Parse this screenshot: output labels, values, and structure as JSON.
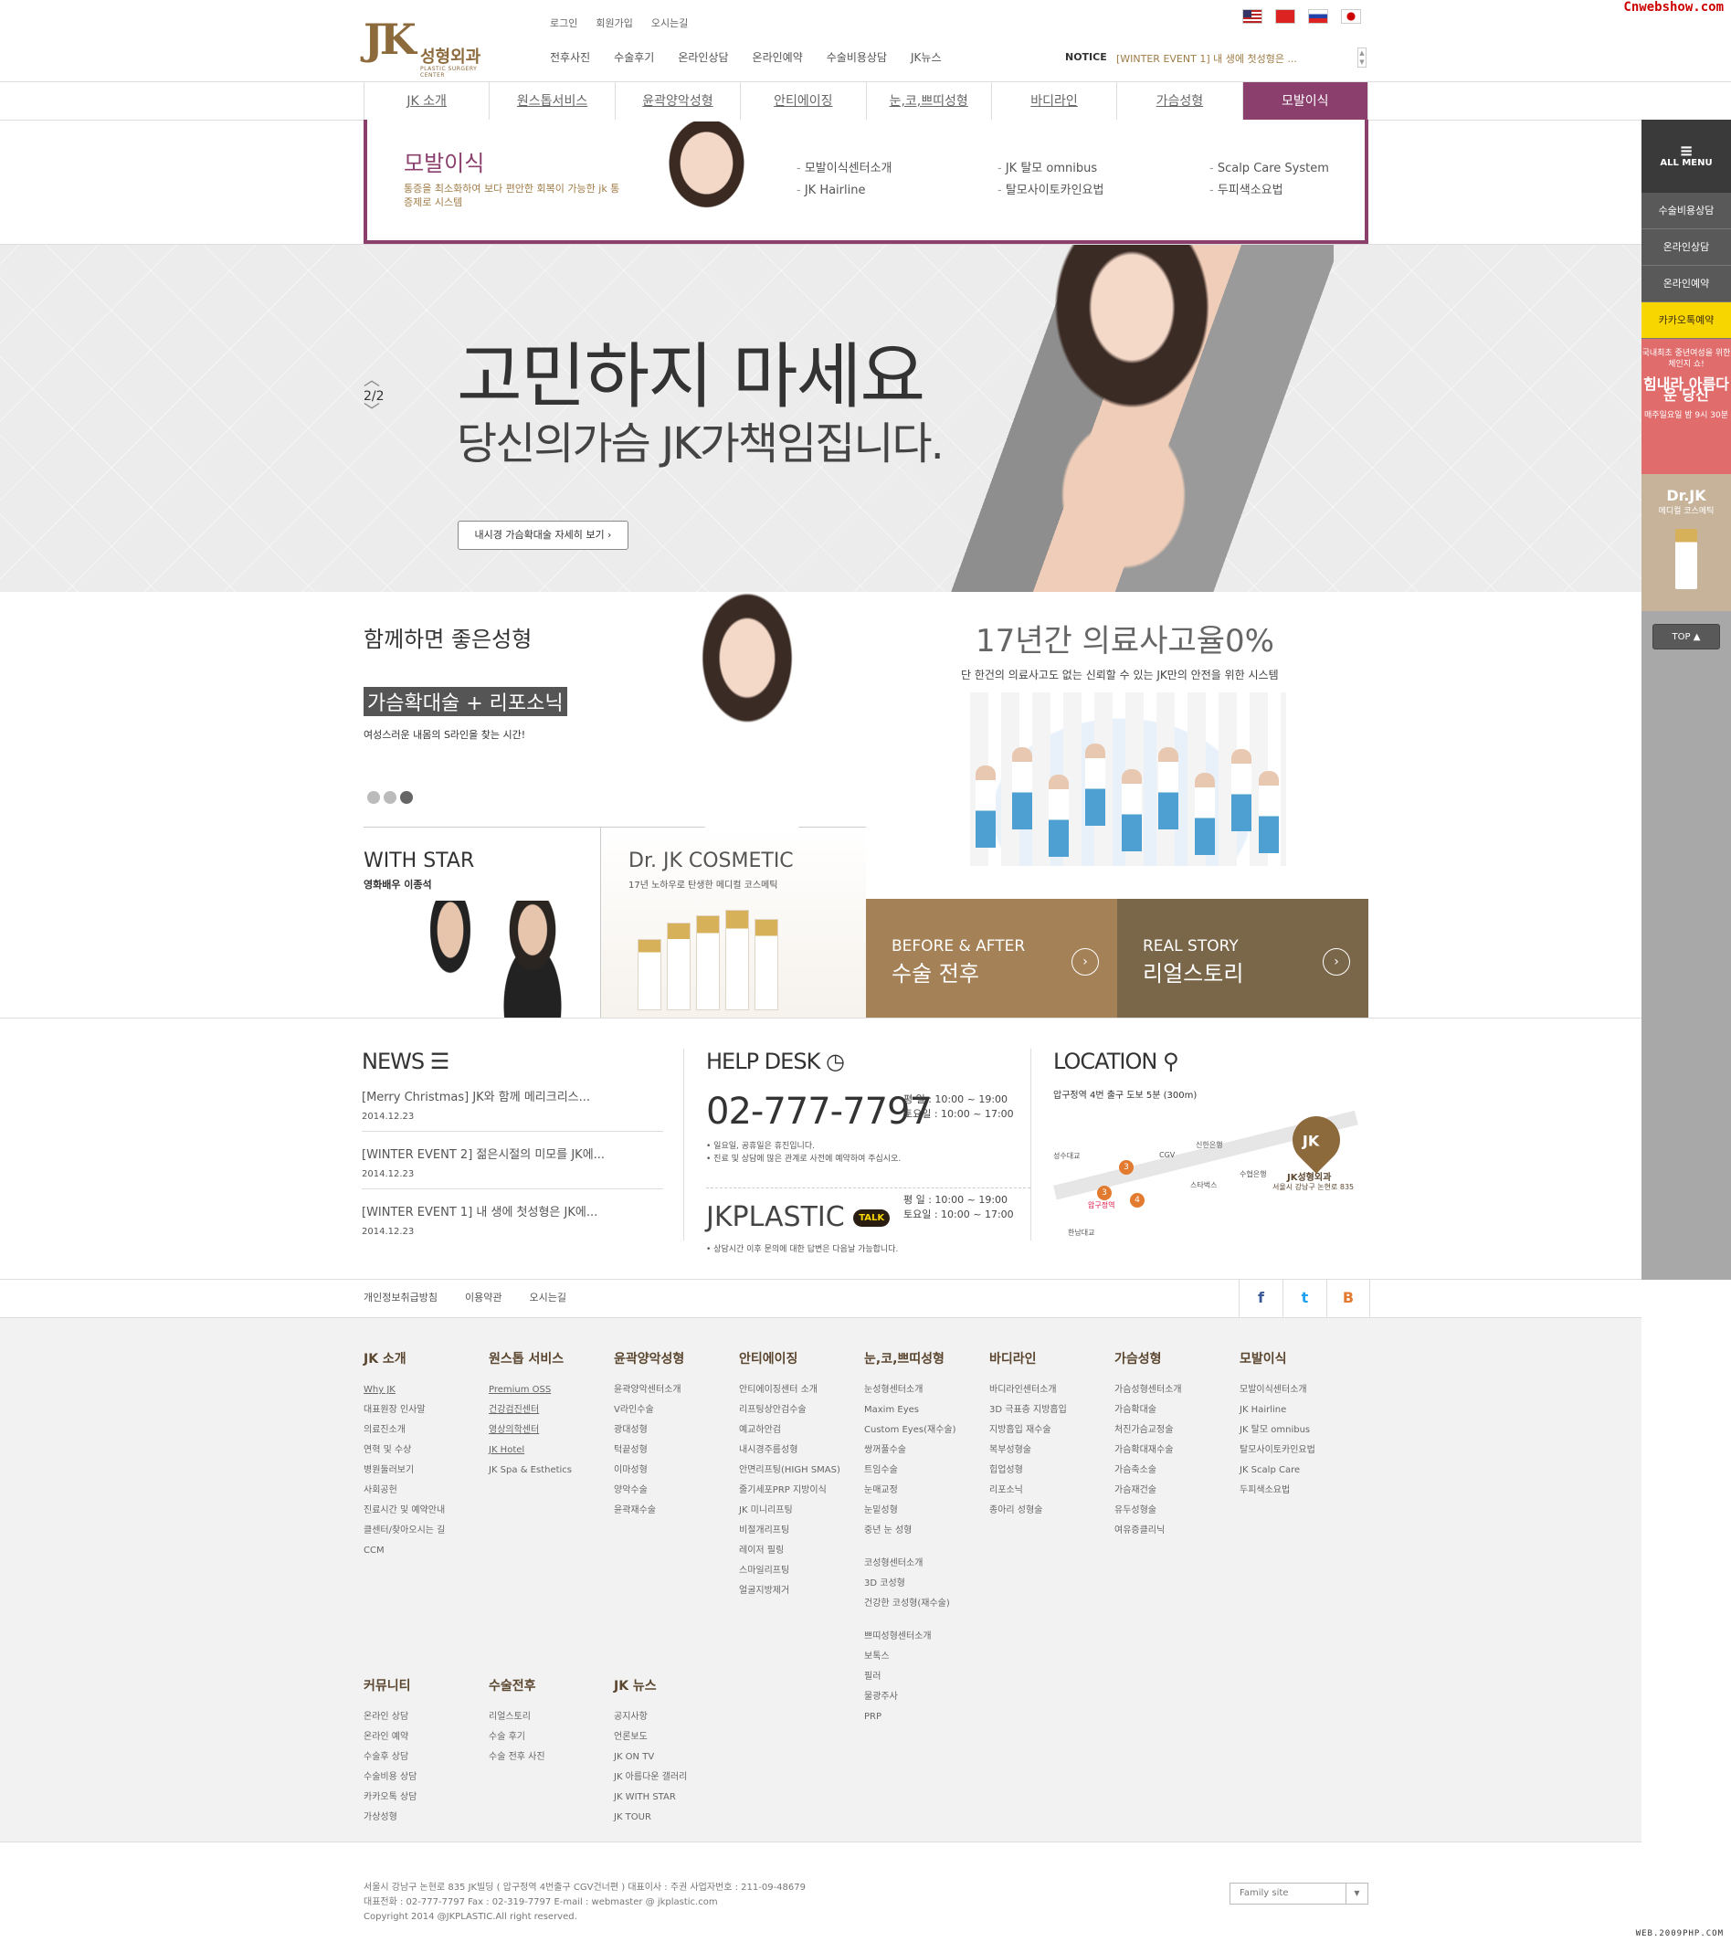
{
  "watermark_top": "Cnwebshow.com",
  "watermark_bottom": "WEB.2009PHP.COM",
  "logo": {
    "mark": "JK",
    "name": "성형외과",
    "sub": "PLASTIC SURGERY CENTER"
  },
  "utility": [
    "로그인",
    "회원가입",
    "오시는길"
  ],
  "gnb": [
    "전후사진",
    "수술후기",
    "온라인상담",
    "온라인예약",
    "수술비용상담",
    "JK뉴스"
  ],
  "notice": {
    "label": "NOTICE",
    "text": "[WINTER EVENT 1] 내 생에 첫성형은 ..."
  },
  "tabs": [
    "JK 소개",
    "원스톱서비스",
    "윤곽양악성형",
    "안티에이징",
    "눈,코,쁘띠성형",
    "바디라인",
    "가슴성형",
    "모발이식"
  ],
  "subpanel": {
    "title": "모발이식",
    "desc": "통증을 최소화하여 보다 편안한 회복이 가능한 jk 통증제로 시스템",
    "col1": [
      "모발이식센터소개",
      "JK Hairline"
    ],
    "col2": [
      "JK 탈모 omnibus",
      "탈모사이토카인요법"
    ],
    "col3": [
      "Scalp Care System",
      "두피색소요법"
    ]
  },
  "hero": {
    "line1": "고민하지 마세요",
    "line2": "당신의가슴 JK가책임집니다.",
    "button": "내시경 가슴확대술 자세히 보기 ›",
    "page_current": "2",
    "page_total": "/2"
  },
  "promo": {
    "title": "함께하면 좋은성형",
    "badge": "가슴확대술 + 리포소닉",
    "desc": "여성스러운 내몸의 S라인을 찾는 시간!"
  },
  "with_star": {
    "title": "WITH STAR",
    "desc": "영화배우 이종석"
  },
  "cosmetic": {
    "title": "Dr. JK COSMETIC",
    "desc": "17년 노하우로 탄생한 메디컬 코스메틱"
  },
  "stat": {
    "title": "17년간 의료사고율0%",
    "desc": "단 한건의 의료사고도 없는 신뢰할 수 있는 JK만의 안전을 위한 시스템"
  },
  "before_after": {
    "en": "BEFORE & AFTER",
    "ko": "수술 전후"
  },
  "real_story": {
    "en": "REAL STORY",
    "ko": "리얼스토리"
  },
  "news": {
    "title": "NEWS",
    "items": [
      {
        "title": "[Merry Christmas] JK와 함께 메리크리스...",
        "date": "2014.12.23"
      },
      {
        "title": "[WINTER EVENT 2] 젊은시절의 미모를 JK에...",
        "date": "2014.12.23"
      },
      {
        "title": "[WINTER EVENT 1] 내 생에 첫성형은 JK에...",
        "date": "2014.12.23"
      }
    ]
  },
  "help": {
    "title": "HELP DESK",
    "phone": "02-777-7797",
    "hours": [
      "평 일 : 10:00 ~ 19:00",
      "토요일 : 10:00 ~ 17:00"
    ],
    "notes": [
      "• 일요일, 공휴일은 휴진입니다.",
      "• 진료 및 상담에 많은 관계로 사전에 예약하여 주십시오."
    ],
    "kakao": "JKPLASTIC",
    "kakao_badge": "TALK",
    "hours2": [
      "평 일 : 10:00 ~ 19:00",
      "토요일 : 10:00 ~ 17:00"
    ],
    "note2": "• 상담시간 이후 문의에 대한 답변은 다음날 가능합니다."
  },
  "location": {
    "title": "LOCATION",
    "desc": "압구정역 4번 출구 도보 5분 (300m)",
    "labels": [
      "성수대교",
      "CGV",
      "신한은행",
      "스타벅스",
      "수협은행",
      "압구정역",
      "한남대교",
      "JK성형외과",
      "서울시 강남구 논현로 835"
    ],
    "nums": [
      "3",
      "3",
      "4"
    ]
  },
  "footer_links": [
    "개인정보취급방침",
    "이용약관",
    "오시는길"
  ],
  "social": [
    "f",
    "t",
    "B"
  ],
  "sitemap": [
    {
      "h": "JK 소개",
      "items": [
        "Why JK",
        "대표원장 인사말",
        "의료진소개",
        "연혁 및 수상",
        "병원둘러보기",
        "사회공헌",
        "진료시간 및 예약안내",
        "클센터/찾아오시는 길",
        "CCM"
      ]
    },
    {
      "h": "원스톱 서비스",
      "items": [
        "Premium OSS",
        "건강검진센터",
        "영상의학센터",
        "JK Hotel",
        "JK Spa & Esthetics"
      ]
    },
    {
      "h": "윤곽양악성형",
      "items": [
        "윤곽양악센터소개",
        "V라인수술",
        "광대성형",
        "턱끝성형",
        "이마성형",
        "양악수술",
        "윤곽재수술"
      ]
    },
    {
      "h": "안티에이징",
      "items": [
        "안티에이징센터 소개",
        "리프팅상안검수술",
        "예교하안검",
        "내시경주름성형",
        "안면리프팅(HIGH SMAS)",
        "줄기세포PRP 지방이식",
        "JK 미니리프팅",
        "비절개리프팅",
        "레이저 필링",
        "스마일리프팅",
        "얼굴지방제거"
      ]
    },
    {
      "h": "눈,코,쁘띠성형",
      "items": [
        "눈성형센터소개",
        "Maxim Eyes",
        "Custom Eyes(재수술)",
        "쌍꺼풀수술",
        "트임수술",
        "눈매교정",
        "눈밑성형",
        "중년 눈 성형"
      ],
      "items2": [
        "코성형센터소개",
        "3D 코성형",
        "건강한 코성형(재수술)"
      ],
      "items3": [
        "쁘띠성형센터소개",
        "보톡스",
        "필러",
        "물광주사",
        "PRP"
      ]
    },
    {
      "h": "바디라인",
      "items": [
        "바디라인센터소개",
        "3D 극표층 지방흡입",
        "지방흡입 재수술",
        "복부성형술",
        "힙업성형",
        "리포소닉",
        "종아리 성형술"
      ]
    },
    {
      "h": "가슴성형",
      "items": [
        "가슴성형센터소개",
        "가슴확대술",
        "처진가슴교정술",
        "가슴확대재수술",
        "가슴축소술",
        "가슴재건술",
        "유두성형술",
        "여유증클리닉"
      ]
    },
    {
      "h": "모발이식",
      "items": [
        "모발이식센터소개",
        "JK Hairline",
        "JK 탈모 omnibus",
        "탈모사이토카인요법",
        "JK Scalp Care",
        "두피색소요법"
      ]
    }
  ],
  "sitemap2": [
    {
      "h": "커뮤니티",
      "items": [
        "온라인 상담",
        "온라인 예약",
        "수술후 상담",
        "수술비용 상담",
        "카카오톡 상담",
        "가상성형"
      ]
    },
    {
      "h": "수술전후",
      "items": [
        "리얼스토리",
        "수술 후기",
        "수술 전후 사진"
      ]
    },
    {
      "h": "JK 뉴스",
      "items": [
        "공지사항",
        "언론보도",
        "JK ON TV",
        "JK 아름다운 갤러리",
        "JK WITH STAR",
        "JK TOUR"
      ]
    }
  ],
  "address": [
    "서울시 강남구 논현로 835 JK빌딩 ( 압구정역 4번출구 CGV건너편 ) 대표이사 : 주권  사업자번호 : 211-09-48679",
    "대표전화 : 02-777-7797  Fax : 02-319-7797  E-mail : webmaster @ jkplastic.com",
    "Copyright 2014 @JKPLASTIC.All right reserved."
  ],
  "family_site": "Family site",
  "quick": {
    "all": "ALL MENU",
    "items": [
      "수술비용상담",
      "온라인상담",
      "온라인예약",
      "카카오톡예약"
    ],
    "ad1_top": "국내최초 중년여성을 위한 체인지 쇼!",
    "ad1_big": "힘내라 아름다운 당신",
    "ad1_bottom": "매주일요일 밤 9시 30분",
    "ad2_big": "Dr.JK",
    "ad2_sub": "메디컬 코스메틱",
    "top": "TOP ▲"
  }
}
